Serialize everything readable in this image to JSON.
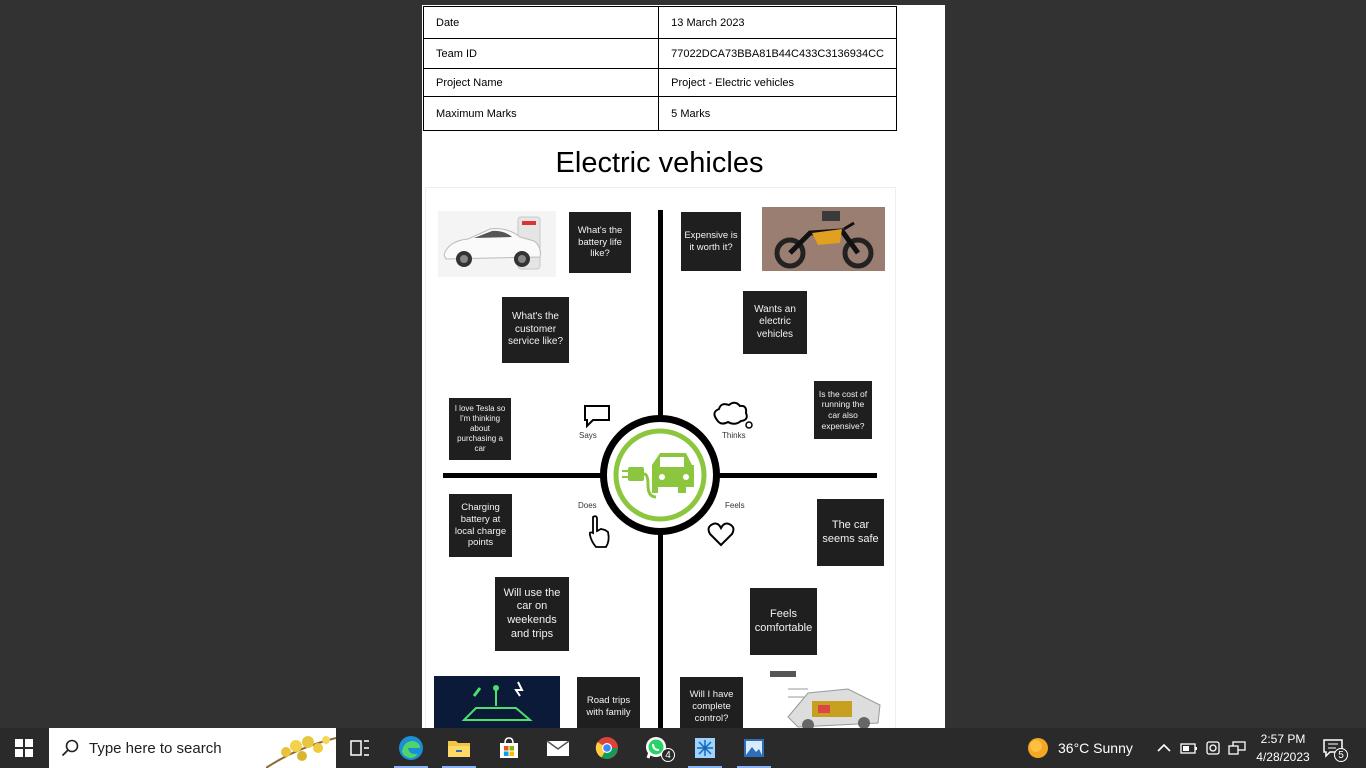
{
  "document": {
    "info": [
      {
        "label": "Date",
        "value": "13 March 2023"
      },
      {
        "label": "Team ID",
        "value": "77022DCA73BBA81B44C433C3136934CC"
      },
      {
        "label": "Project Name",
        "value": "Project - Electric vehicles"
      },
      {
        "label": "Maximum Marks",
        "value": "5 Marks"
      }
    ],
    "title": "Electric vehicles",
    "quadrants": {
      "says": "Says",
      "thinks": "Thinks",
      "does": "Does",
      "feels": "Feels"
    },
    "notes": {
      "battery_life": "What's the battery life like?",
      "expensive": "Expensive is it worth it?",
      "customer_service": "What's the customer service like?",
      "wants_ev": "Wants an electric vehicles",
      "love_tesla": "I love Tesla so I'm thinking about purchasing a car",
      "running_cost": "Is the cost of running the car also expensive?",
      "charging": "Charging battery at local charge points",
      "seems_safe": "The car seems safe",
      "weekends": "Will use the car on weekends and trips",
      "comfortable": "Feels comfortable",
      "road_trips": "Road trips with family",
      "complete_control": "Will I have complete control?"
    }
  },
  "taskbar": {
    "search_placeholder": "Type here to search",
    "whatsapp_badge": "4",
    "weather": "36°C  Sunny",
    "time": "2:57 PM",
    "date": "4/28/2023",
    "notifications_count": "5"
  },
  "colors": {
    "note_bg": "#1f1f1f",
    "ev_green": "#8cc63f",
    "taskbar_bg": "#2a2a2a"
  }
}
